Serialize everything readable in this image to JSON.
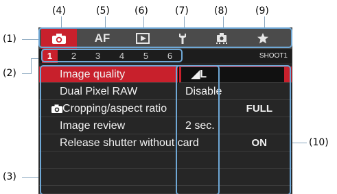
{
  "callouts": {
    "c1": "(1)",
    "c2": "(2)",
    "c3": "(3)",
    "c4": "(4)",
    "c5": "(5)",
    "c6": "(6)",
    "c7": "(7)",
    "c8": "(8)",
    "c9": "(9)",
    "c10": "(10)"
  },
  "tabs": [
    {
      "icon": "camera-icon",
      "active": true
    },
    {
      "label": "AF",
      "icon": "af-text"
    },
    {
      "icon": "playback-icon"
    },
    {
      "icon": "wrench-icon"
    },
    {
      "icon": "custom-function-icon"
    },
    {
      "icon": "star-icon"
    }
  ],
  "subtabs": [
    "1",
    "2",
    "3",
    "4",
    "5",
    "6"
  ],
  "current_tab_label": "SHOOT1",
  "menu": [
    {
      "label": "Image quality",
      "value": "◢L",
      "selected": true
    },
    {
      "label": "Dual Pixel RAW",
      "value": "Disable"
    },
    {
      "label": "Cropping/aspect ratio",
      "label_icon": "camera-icon",
      "value": "FULL"
    },
    {
      "label": "Image review",
      "value": "2 sec."
    },
    {
      "label": "Release shutter without card",
      "value": "ON"
    },
    {
      "label": ""
    },
    {
      "label": ""
    }
  ],
  "colors": {
    "accent": "#c8202c",
    "highlight": "#6fa8d6",
    "leader": "#8aa7bf"
  }
}
